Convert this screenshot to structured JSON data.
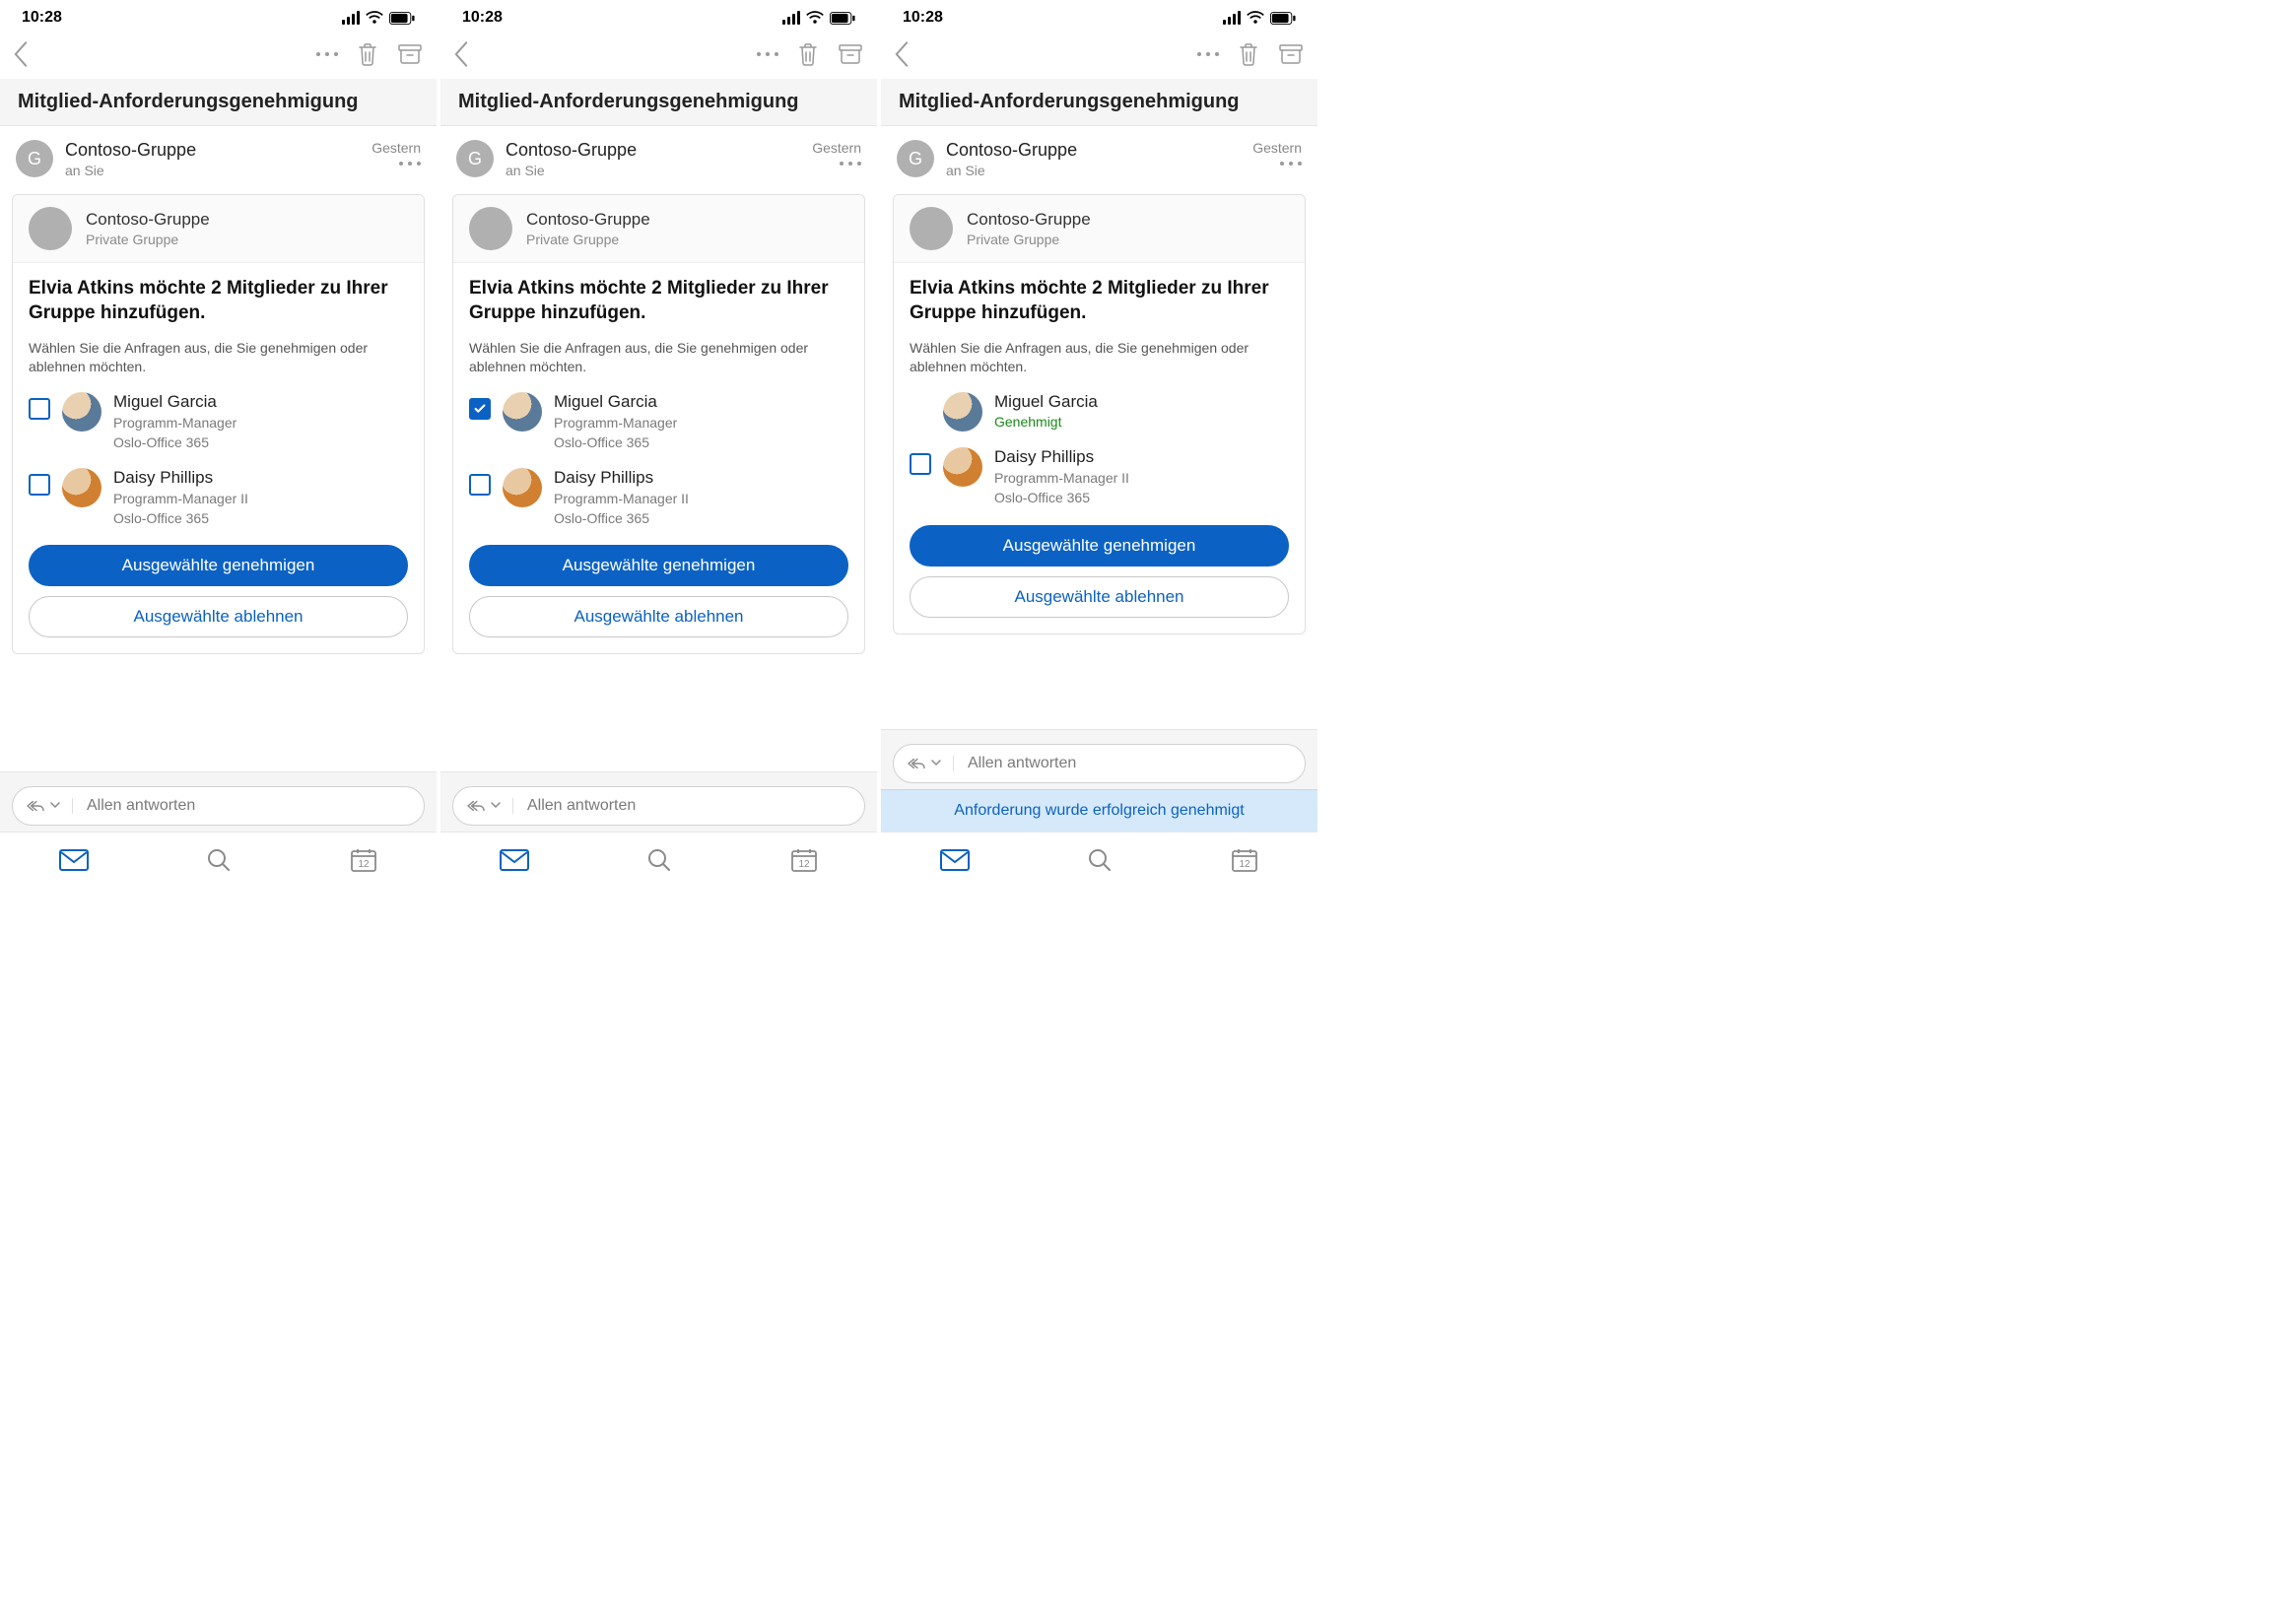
{
  "clock": "10:28",
  "subject": "Mitglied-Anforderungsgenehmigung",
  "sender": {
    "name": "Contoso-Gruppe",
    "initial": "G",
    "to": "an Sie",
    "date": "Gestern"
  },
  "group_card": {
    "name": "Contoso-Gruppe",
    "subtitle": "Private Gruppe"
  },
  "request_title": "Elvia Atkins möchte 2 Mitglieder zu Ihrer Gruppe hinzufügen.",
  "request_instruction": "Wählen Sie die Anfragen aus, die Sie genehmigen oder ablehnen möchten.",
  "members": {
    "m1": {
      "name": "Miguel Garcia",
      "role": "Programm-Manager",
      "office": "Oslo-Office 365",
      "approved_label": "Genehmigt"
    },
    "m2": {
      "name": "Daisy Phillips",
      "role": "Programm-Manager II",
      "office": "Oslo-Office 365"
    }
  },
  "buttons": {
    "approve": "Ausgewählte genehmigen",
    "reject": "Ausgewählte ablehnen"
  },
  "reply_placeholder": "Allen antworten",
  "toast_success": "Anforderung wurde erfolgreich genehmigt",
  "calendar_day": "12",
  "screens": [
    {
      "m1_checked": false,
      "m1_approved": false,
      "show_toast": false
    },
    {
      "m1_checked": true,
      "m1_approved": false,
      "show_toast": false
    },
    {
      "m1_checked": false,
      "m1_approved": true,
      "show_toast": true
    }
  ]
}
